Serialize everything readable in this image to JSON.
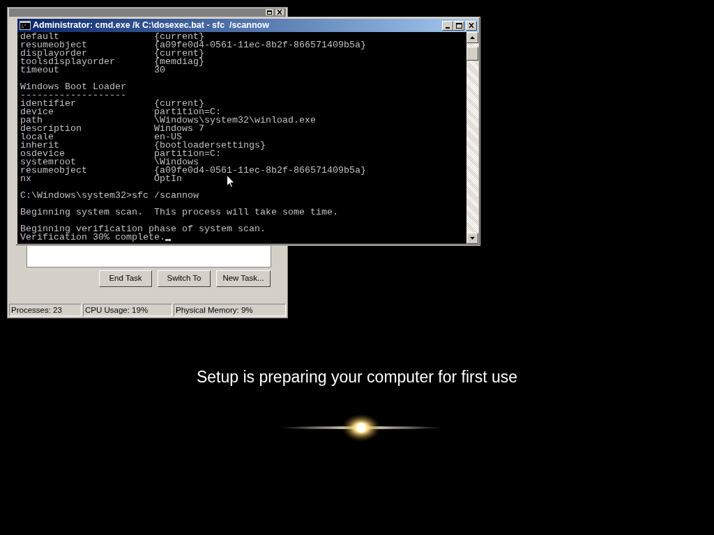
{
  "task_manager": {
    "buttons": [
      "End Task",
      "Switch To",
      "New Task..."
    ],
    "status_bar": [
      "Processes: 23",
      "CPU Usage: 19%",
      "Physical Memory: 9%"
    ]
  },
  "console": {
    "title": "Administrator: cmd.exe /k C:\\dosexec.bat - sfc  /scannow",
    "lines": [
      {
        "kind": "pair",
        "key": "default",
        "value": "{current}"
      },
      {
        "kind": "pair",
        "key": "resumeobject",
        "value": "{a09fe0d4-0561-11ec-8b2f-866571409b5a}"
      },
      {
        "kind": "pair",
        "key": "displayorder",
        "value": "{current}"
      },
      {
        "kind": "pair",
        "key": "toolsdisplayorder",
        "value": "{memdiag}"
      },
      {
        "kind": "pair",
        "key": "timeout",
        "value": "30"
      },
      {
        "kind": "blank"
      },
      {
        "kind": "text",
        "text": "Windows Boot Loader"
      },
      {
        "kind": "text",
        "text": "-------------------"
      },
      {
        "kind": "pair",
        "key": "identifier",
        "value": "{current}"
      },
      {
        "kind": "pair",
        "key": "device",
        "value": "partition=C:"
      },
      {
        "kind": "pair",
        "key": "path",
        "value": "\\Windows\\system32\\winload.exe"
      },
      {
        "kind": "pair",
        "key": "description",
        "value": "Windows 7"
      },
      {
        "kind": "pair",
        "key": "locale",
        "value": "en-US"
      },
      {
        "kind": "pair",
        "key": "inherit",
        "value": "{bootloadersettings}"
      },
      {
        "kind": "pair",
        "key": "osdevice",
        "value": "partition=C:"
      },
      {
        "kind": "pair",
        "key": "systemroot",
        "value": "\\Windows"
      },
      {
        "kind": "pair",
        "key": "resumeobject",
        "value": "{a09fe0d4-0561-11ec-8b2f-866571409b5a}"
      },
      {
        "kind": "pair",
        "key": "nx",
        "value": "OptIn"
      },
      {
        "kind": "blank"
      },
      {
        "kind": "text",
        "text": "C:\\Windows\\system32>sfc /scannow"
      },
      {
        "kind": "blank"
      },
      {
        "kind": "text",
        "text": "Beginning system scan.  This process will take some time."
      },
      {
        "kind": "blank"
      },
      {
        "kind": "text",
        "text": "Beginning verification phase of system scan."
      },
      {
        "kind": "text",
        "text": "Verification 30% complete.",
        "cursor": true
      }
    ]
  },
  "setup_message": "Setup is preparing your computer for first use"
}
